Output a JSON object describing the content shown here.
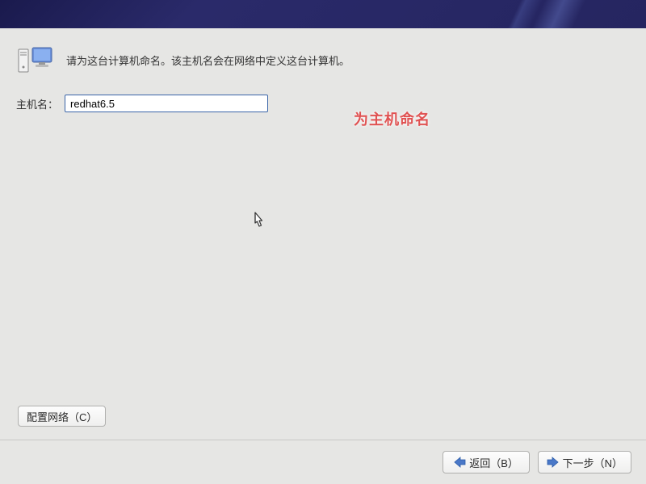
{
  "intro_text": "请为这台计算机命名。该主机名会在网络中定义这台计算机。",
  "hostname_label": "主机名：",
  "hostname_value": "redhat6.5",
  "annotation_text": "为主机命名",
  "config_network_label": "配置网络（C）",
  "back_label": "返回（B）",
  "next_label": "下一步（N）"
}
